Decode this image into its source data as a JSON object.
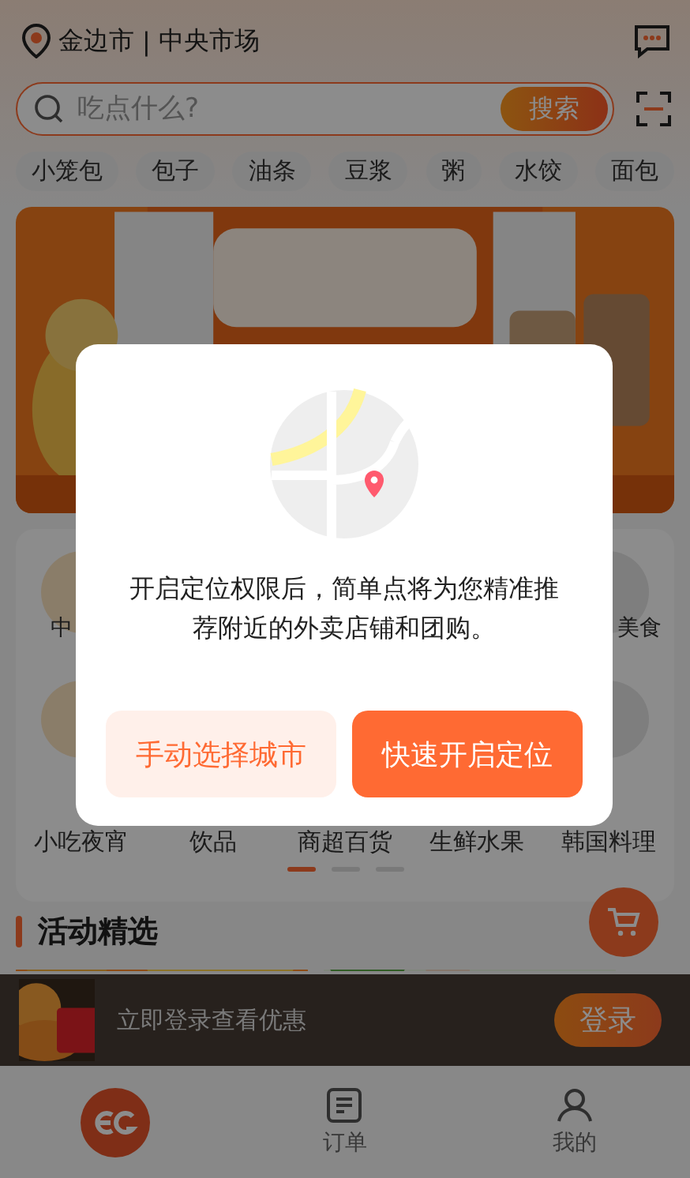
{
  "header": {
    "city": "金边市",
    "separator": "|",
    "market": "中央市场"
  },
  "search": {
    "placeholder": "吃点什么?",
    "button": "搜索"
  },
  "chips": [
    "小笼包",
    "包子",
    "油条",
    "豆浆",
    "粥",
    "水饺",
    "面包"
  ],
  "category_row_1": {
    "left": "中",
    "right": "美食"
  },
  "category_row_2": [
    "小吃夜宵",
    "饮品",
    "商超百货",
    "生鲜水果",
    "韩国料理"
  ],
  "page_dots": [
    {
      "selected": true
    },
    {
      "selected": false
    },
    {
      "selected": false
    }
  ],
  "section_title": "活动精选",
  "login_bar": {
    "text": "立即登录查看优惠",
    "button": "登录"
  },
  "tabs": [
    {
      "kind": "logo",
      "selected": true
    },
    {
      "kind": "orders",
      "label": "订单",
      "selected": false
    },
    {
      "kind": "profile",
      "label": "我的",
      "selected": false
    }
  ],
  "dialog": {
    "message": "开启定位权限后，简单点将为您精准推荐附近的外卖店铺和团购。",
    "buttons": [
      {
        "label": "手动选择城市",
        "kind": "secondary"
      },
      {
        "label": "快速开启定位",
        "kind": "primary"
      }
    ]
  }
}
